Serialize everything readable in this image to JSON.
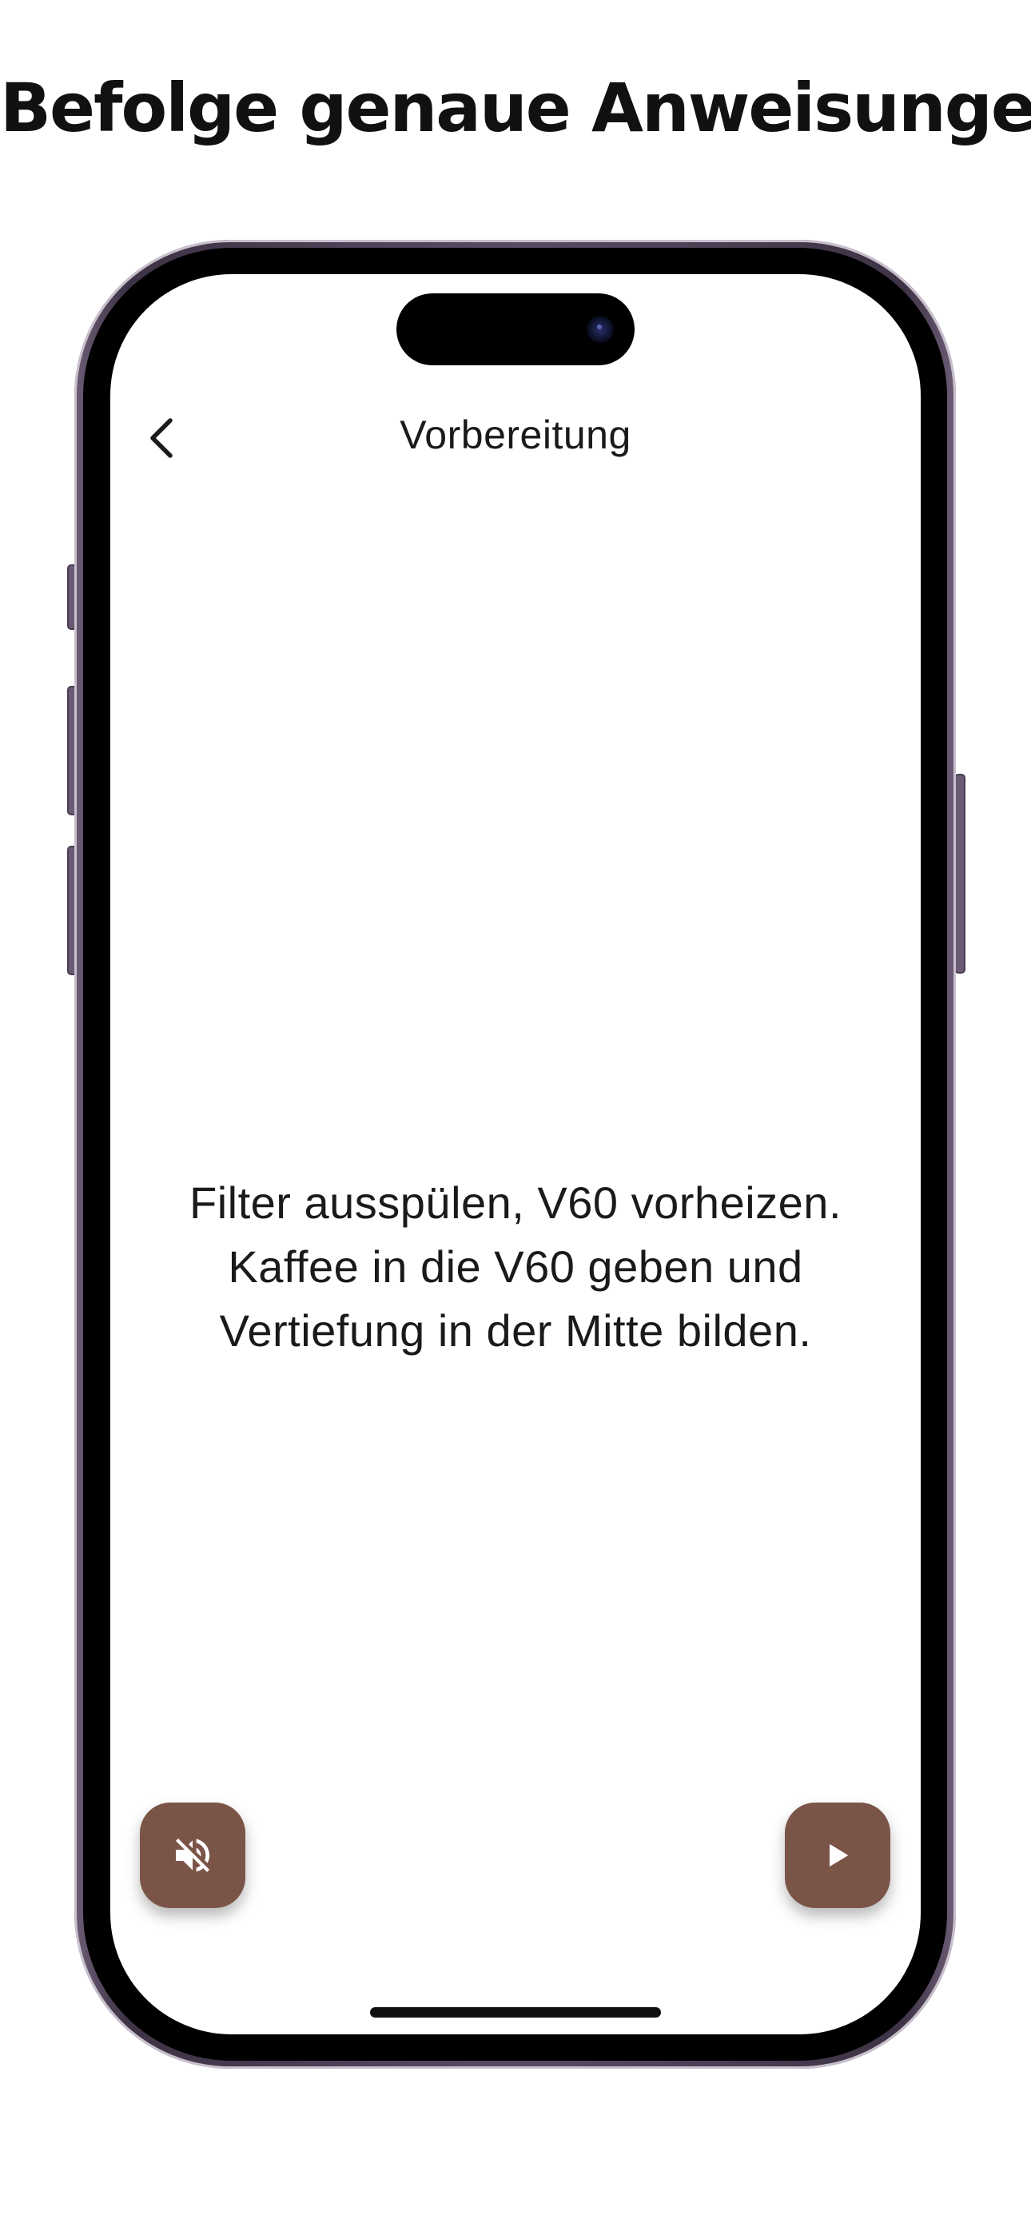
{
  "headline": "Befolge genaue Anweisungen",
  "screen": {
    "title": "Vorbereitung",
    "instruction_lines": [
      "Filter ausspülen, V60 vorheizen.",
      "Kaffee in die V60 geben und",
      "Vertiefung in der Mitte bilden."
    ],
    "icons": {
      "back": "chevron-left-icon",
      "mute": "volume-off-icon",
      "play": "play-icon"
    }
  },
  "colors": {
    "accent": "#7b5448",
    "phone_frame": "#5a4a62",
    "text": "#1a1a1a"
  }
}
